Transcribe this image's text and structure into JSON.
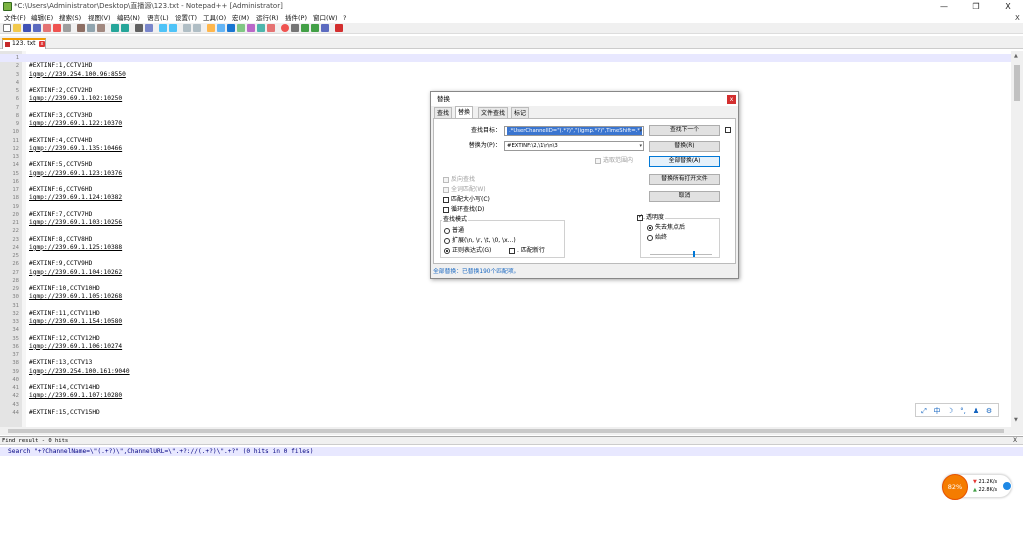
{
  "window": {
    "title": "*C:\\Users\\Administrator\\Desktop\\直播源\\123.txt - Notepad++ [Administrator]",
    "minimize": "—",
    "maximize": "❐",
    "close": "X"
  },
  "menu": {
    "items": [
      "文件(F)",
      "编辑(E)",
      "搜索(S)",
      "视图(V)",
      "编码(N)",
      "语言(L)",
      "设置(T)",
      "工具(O)",
      "宏(M)",
      "运行(R)",
      "插件(P)",
      "窗口(W)",
      "?"
    ],
    "close_x": "X"
  },
  "tab": {
    "label": "123. txt",
    "close": "x"
  },
  "editor": {
    "lines": [
      {
        "n": "1",
        "t": "",
        "url": false
      },
      {
        "n": "2",
        "t": "#EXTINF:1,CCTV1HD",
        "url": false
      },
      {
        "n": "3",
        "t": "igmp://239.254.100.96:8550",
        "url": true
      },
      {
        "n": "4",
        "t": "",
        "url": false
      },
      {
        "n": "5",
        "t": "#EXTINF:2,CCTV2HD",
        "url": false
      },
      {
        "n": "6",
        "t": "igmp://239.69.1.102:10250",
        "url": true
      },
      {
        "n": "7",
        "t": "",
        "url": false
      },
      {
        "n": "8",
        "t": "#EXTINF:3,CCTV3HD",
        "url": false
      },
      {
        "n": "9",
        "t": "igmp://239.69.1.122:10370",
        "url": true
      },
      {
        "n": "10",
        "t": "",
        "url": false
      },
      {
        "n": "11",
        "t": "#EXTINF:4,CCTV4HD",
        "url": false
      },
      {
        "n": "12",
        "t": "igmp://239.69.1.135:10466",
        "url": true
      },
      {
        "n": "13",
        "t": "",
        "url": false
      },
      {
        "n": "14",
        "t": "#EXTINF:5,CCTV5HD",
        "url": false
      },
      {
        "n": "15",
        "t": "igmp://239.69.1.123:10376",
        "url": true
      },
      {
        "n": "16",
        "t": "",
        "url": false
      },
      {
        "n": "17",
        "t": "#EXTINF:6,CCTV6HD",
        "url": false
      },
      {
        "n": "18",
        "t": "igmp://239.69.1.124:10382",
        "url": true
      },
      {
        "n": "19",
        "t": "",
        "url": false
      },
      {
        "n": "20",
        "t": "#EXTINF:7,CCTV7HD",
        "url": false
      },
      {
        "n": "21",
        "t": "igmp://239.69.1.103:10256",
        "url": true
      },
      {
        "n": "22",
        "t": "",
        "url": false
      },
      {
        "n": "23",
        "t": "#EXTINF:8,CCTV8HD",
        "url": false
      },
      {
        "n": "24",
        "t": "igmp://239.69.1.125:10388",
        "url": true
      },
      {
        "n": "25",
        "t": "",
        "url": false
      },
      {
        "n": "26",
        "t": "#EXTINF:9,CCTV9HD",
        "url": false
      },
      {
        "n": "27",
        "t": "igmp://239.69.1.104:10262",
        "url": true
      },
      {
        "n": "28",
        "t": "",
        "url": false
      },
      {
        "n": "29",
        "t": "#EXTINF:10,CCTV10HD",
        "url": false
      },
      {
        "n": "30",
        "t": "igmp://239.69.1.105:10268",
        "url": true
      },
      {
        "n": "31",
        "t": "",
        "url": false
      },
      {
        "n": "32",
        "t": "#EXTINF:11,CCTV11HD",
        "url": false
      },
      {
        "n": "33",
        "t": "igmp://239.69.1.154:10580",
        "url": true
      },
      {
        "n": "34",
        "t": "",
        "url": false
      },
      {
        "n": "35",
        "t": "#EXTINF:12,CCTV12HD",
        "url": false
      },
      {
        "n": "36",
        "t": "igmp://239.69.1.106:10274",
        "url": true
      },
      {
        "n": "37",
        "t": "",
        "url": false
      },
      {
        "n": "38",
        "t": "#EXTINF:13,CCTV13",
        "url": false
      },
      {
        "n": "39",
        "t": "igmp://239.254.100.161:9040",
        "url": true
      },
      {
        "n": "40",
        "t": "",
        "url": false
      },
      {
        "n": "41",
        "t": "#EXTINF:14,CCTV14HD",
        "url": false
      },
      {
        "n": "42",
        "t": "igmp://239.69.1.107:10280",
        "url": true
      },
      {
        "n": "43",
        "t": "",
        "url": false
      },
      {
        "n": "44",
        "t": "#EXTINF:15,CCTV15HD",
        "url": false
      }
    ]
  },
  "ime": {
    "items": [
      "⤢",
      "中",
      "☽",
      "°,",
      "♟",
      "⚙"
    ]
  },
  "find_result": {
    "title": "Find result - 0 hits",
    "close": "X",
    "line": "Search \"+?ChannelName=\\\"(.+?)\\\",ChannelURL=\\\".+?://(.+?)\\\".+?\" (0 hits in 0 files)"
  },
  "speed": {
    "percent": "82%",
    "up": "21.2K/s",
    "down": "22.8K/s"
  },
  "dialog": {
    "title": "替换",
    "close": "x",
    "tabs": [
      "查找",
      "替换",
      "文件查找",
      "标记"
    ],
    "find_label": "查找目标：",
    "find_value": ".*UserChannelID=\"(.*?)\",\"(igmp.*?)\",TimeShift=.*",
    "replace_label": "替换为(P)：",
    "replace_value": "#EXTINF:\\2,\\1\\r\\n\\3",
    "in_selection": "选取范围内",
    "buttons": {
      "find_next": "查找下一个",
      "replace": "替换(R)",
      "replace_all": "全部替换(A)",
      "replace_all_open": "替换所有打开文件",
      "cancel": "取消"
    },
    "options": {
      "backward": "反向查找",
      "whole_word": "全词匹配(W)",
      "match_case": "匹配大小写(C)",
      "wrap": "循环查找(D)"
    },
    "search_mode": {
      "title": "查找模式",
      "normal": "普通",
      "extended": "扩展(\\n, \\r, \\t, \\0, \\x...)",
      "regex": "正则表达式(G)",
      "dot_newline": ". 匹配新行"
    },
    "transparency": {
      "title": "透明度",
      "on_lose_focus": "失去焦点后",
      "always": "始终"
    },
    "status": "全部替换：已替换190个匹配项。"
  }
}
